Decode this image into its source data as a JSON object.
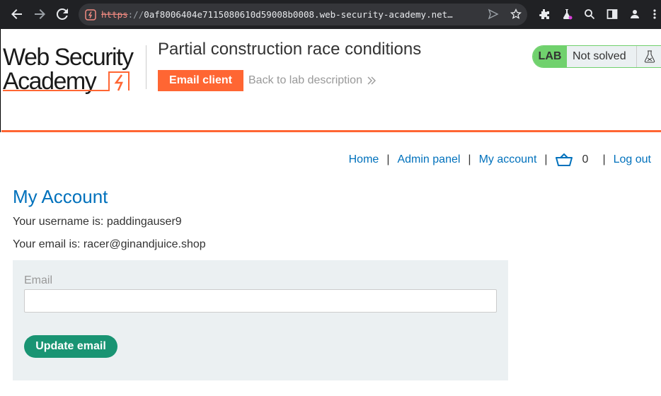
{
  "browser": {
    "url_scheme": "https",
    "url_sep": "://",
    "url_rest": "0af8006404e7115080610d59008b0008.web-security-academy.net…"
  },
  "lab": {
    "title": "Partial construction race conditions",
    "email_client_label": "Email client",
    "back_link_label": "Back to lab description",
    "badge": "LAB",
    "status": "Not solved",
    "logo_line1": "Web Security",
    "logo_line2": "Academy"
  },
  "nav": {
    "home": "Home",
    "admin": "Admin panel",
    "account": "My account",
    "cart_count": "0",
    "logout": "Log out",
    "separator": "|"
  },
  "account": {
    "title": "My Account",
    "username_line": "Your username is: paddingauser9",
    "email_line": "Your email is: racer@ginandjuice.shop",
    "email_label": "Email",
    "email_value": "",
    "update_button": "Update email"
  },
  "colors": {
    "accent": "#ff6633",
    "link": "#0071bc",
    "success": "#70d16d",
    "button_green": "#199473"
  }
}
